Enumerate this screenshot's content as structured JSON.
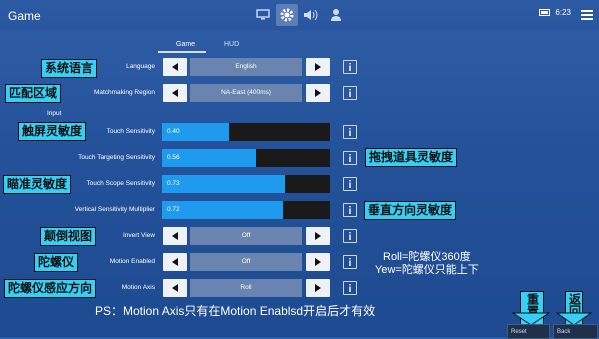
{
  "header": {
    "title": "Game",
    "time": "6:23"
  },
  "tabs": [
    {
      "label": "Game"
    },
    {
      "label": "HUD"
    }
  ],
  "rows": {
    "language": {
      "label": "Language",
      "value": "English"
    },
    "region": {
      "label": "Matchmaking Region",
      "value": "NA-East (400ms)"
    },
    "input_label": "Input",
    "touch": {
      "label": "Touch Sensitivity",
      "value": "0.40",
      "level": 0.4
    },
    "targeting": {
      "label": "Touch Targeting Sensitivity",
      "value": "0.56",
      "level": 0.56
    },
    "scope": {
      "label": "Touch Scope Sensitivity",
      "value": "0.73",
      "level": 0.73
    },
    "vertical": {
      "label": "Vertical Sensitivity Multiplier",
      "value": "0.72",
      "level": 0.72
    },
    "invert": {
      "label": "Invert View",
      "value": "Off"
    },
    "motion": {
      "label": "Motion Enabled",
      "value": "Off"
    },
    "axis": {
      "label": "Motion Axis",
      "value": "Roll"
    }
  },
  "annotations": {
    "language": "系统语言",
    "region": "匹配区域",
    "touch": "触屏灵敏度",
    "targeting": "拖拽道具灵敏度",
    "scope": "瞄准灵敏度",
    "vertical": "垂直方向灵敏度",
    "invert": "颠倒视图",
    "gyro": "陀螺仪",
    "axis": "陀螺仪感应方向",
    "roll": "Roll=陀螺仪360度",
    "yew": "Yew=陀螺仪只能上下",
    "ps": "PS：Motion Axis只有在Motion Enablsd开启后才有效",
    "reset": "重置",
    "back": "返回"
  },
  "footer": {
    "reset": "Reset",
    "back": "Back"
  }
}
